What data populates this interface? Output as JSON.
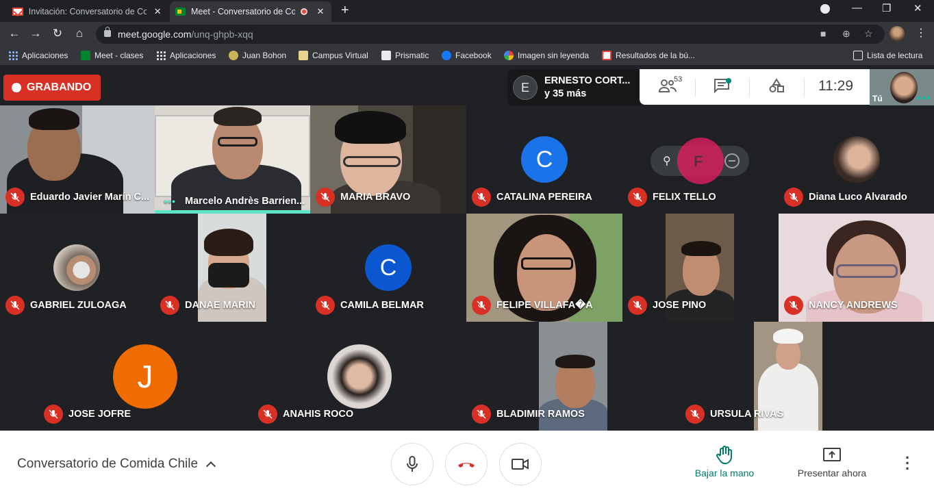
{
  "browser": {
    "tabs": [
      {
        "title": "Invitación: Conversatorio de Com",
        "state": "inactive",
        "icon": "gmail-icon"
      },
      {
        "title": "Meet - Conversatorio de Cor",
        "state": "active",
        "icon": "meet-icon",
        "recording": true
      }
    ],
    "url_domain": "meet.google.com",
    "url_path": "/unq-ghpb-xqq",
    "bookmarks": [
      {
        "label": "Aplicaciones",
        "icon": "apps-grid-icon"
      },
      {
        "label": "Meet - clases",
        "icon": "meet-icon"
      },
      {
        "label": "Aplicaciones",
        "icon": "apps-grid-icon"
      },
      {
        "label": "Juan Bohon",
        "icon": "site-icon"
      },
      {
        "label": "Campus Virtual",
        "icon": "site-icon"
      },
      {
        "label": "Prismatic",
        "icon": "doc-icon"
      },
      {
        "label": "Facebook",
        "icon": "facebook-icon"
      },
      {
        "label": "Imagen sin leyenda",
        "icon": "pinwheel-icon"
      },
      {
        "label": "Resultados de la bú...",
        "icon": "gmail-icon"
      }
    ],
    "reading_list": "Lista de lectura"
  },
  "meet": {
    "recording_label": "GRABANDO",
    "presenter": {
      "initial": "E",
      "line1": "ERNESTO CORT...",
      "line2": "y 35 más"
    },
    "participants_count": "53",
    "clock": "11:29",
    "self_label": "Tú",
    "hover_initial": "F",
    "participants": [
      {
        "name": "Eduardo Javier Marín C..."
      },
      {
        "name": "Marcelo Andrès Barrien..."
      },
      {
        "name": "MARIA BRAVO"
      },
      {
        "name": "CATALINA PEREIRA",
        "initial": "C"
      },
      {
        "name": "FELIX TELLO"
      },
      {
        "name": "Diana Luco Alvarado"
      },
      {
        "name": "GABRIEL ZULOAGA"
      },
      {
        "name": "DANAE MARIN"
      },
      {
        "name": "CAMILA BELMAR",
        "initial": "C"
      },
      {
        "name": "FELIPE VILLAFA�A"
      },
      {
        "name": "JOSE PINO"
      },
      {
        "name": "NANCY ANDREWS"
      },
      {
        "name": "JOSE JOFRE",
        "initial": "J"
      },
      {
        "name": "ANAHIS ROCO"
      },
      {
        "name": "BLADIMIR RAMOS"
      },
      {
        "name": "URSULA RIVAS"
      }
    ],
    "meeting_title": "Conversatorio de Comida Chile",
    "raise_hand": "Bajar la mano",
    "present_now": "Presentar ahora"
  },
  "colors": {
    "record_red": "#d93025",
    "speaking_teal": "#5de3c5",
    "accent_teal": "#00796b",
    "catalina_avatar": "#1a73e8",
    "camila_avatar": "#0b57d0",
    "jofre_avatar": "#ef6c00"
  }
}
